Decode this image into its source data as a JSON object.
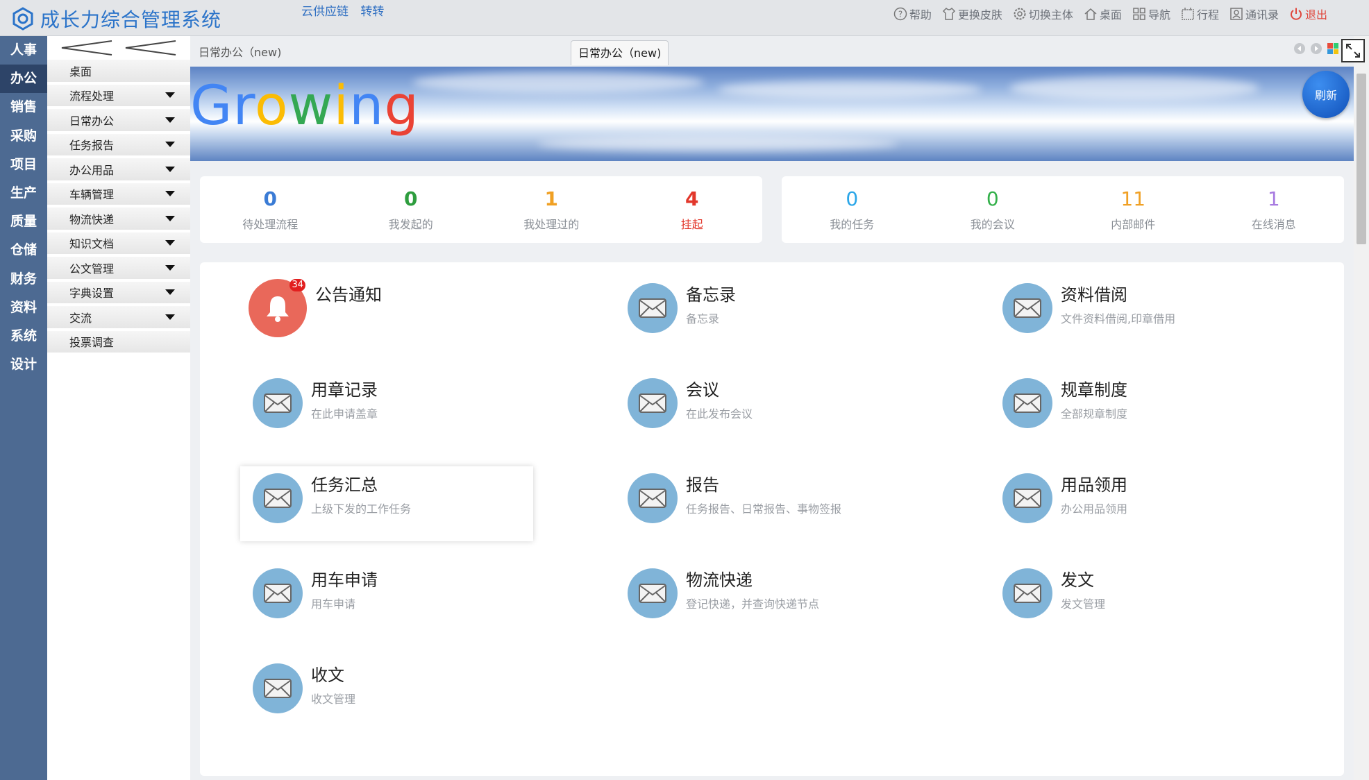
{
  "header": {
    "title": "成长力综合管理系统",
    "links": [
      "云供应链",
      "转转"
    ],
    "tools": [
      {
        "label": "帮助",
        "icon": "help-icon"
      },
      {
        "label": "更换皮肤",
        "icon": "shirt-icon"
      },
      {
        "label": "切换主体",
        "icon": "gear-icon"
      },
      {
        "label": "桌面",
        "icon": "home-icon"
      },
      {
        "label": "导航",
        "icon": "grid-icon"
      },
      {
        "label": "行程",
        "icon": "calendar-icon"
      },
      {
        "label": "通讯录",
        "icon": "contact-icon"
      },
      {
        "label": "退出",
        "icon": "power-icon"
      }
    ]
  },
  "modules": [
    "人事",
    "办公",
    "销售",
    "采购",
    "项目",
    "生产",
    "质量",
    "仓储",
    "财务",
    "资料",
    "系统",
    "设计"
  ],
  "active_module": "办公",
  "menu": [
    "桌面",
    "流程处理",
    "日常办公",
    "任务报告",
    "办公用品",
    "车辆管理",
    "物流快递",
    "知识文档",
    "公文管理",
    "字典设置",
    "交流",
    "投票调查"
  ],
  "breadcrumb": "日常办公（new)",
  "tab": "日常办公（new)",
  "banner": {
    "text": "Growing",
    "refresh_label": "刷新"
  },
  "stats_left": [
    {
      "value": "0",
      "label": "待处理流程",
      "color": "#3a7bd5"
    },
    {
      "value": "0",
      "label": "我发起的",
      "color": "#2e9d3e"
    },
    {
      "value": "1",
      "label": "我处理过的",
      "color": "#f0a024"
    },
    {
      "value": "4",
      "label": "挂起",
      "color": "#e2372b"
    }
  ],
  "stats_right": [
    {
      "value": "0",
      "label": "我的任务",
      "color": "#2aa6e8"
    },
    {
      "value": "0",
      "label": "我的会议",
      "color": "#33b04a"
    },
    {
      "value": "11",
      "label": "内部邮件",
      "color": "#f0a024"
    },
    {
      "value": "1",
      "label": "在线消息",
      "color": "#a77ae0"
    }
  ],
  "apps": [
    {
      "title": "公告通知",
      "sub": "",
      "icon": "bell-icon",
      "badge": "34"
    },
    {
      "title": "备忘录",
      "sub": "备忘录",
      "icon": "mail-icon"
    },
    {
      "title": "资料借阅",
      "sub": "文件资料借阅,印章借用",
      "icon": "mail-icon"
    },
    {
      "title": "用章记录",
      "sub": "在此申请盖章",
      "icon": "mail-icon"
    },
    {
      "title": "会议",
      "sub": "在此发布会议",
      "icon": "mail-icon"
    },
    {
      "title": "规章制度",
      "sub": "全部规章制度",
      "icon": "mail-icon"
    },
    {
      "title": "任务汇总",
      "sub": "上级下发的工作任务",
      "icon": "mail-icon"
    },
    {
      "title": "报告",
      "sub": "任务报告、日常报告、事物签报",
      "icon": "mail-icon"
    },
    {
      "title": "用品领用",
      "sub": "办公用品领用",
      "icon": "mail-icon"
    },
    {
      "title": "用车申请",
      "sub": "用车申请",
      "icon": "mail-icon"
    },
    {
      "title": "物流快递",
      "sub": "登记快递，并查询快递节点",
      "icon": "mail-icon"
    },
    {
      "title": "发文",
      "sub": "发文管理",
      "icon": "mail-icon"
    },
    {
      "title": "收文",
      "sub": "收文管理",
      "icon": "mail-icon"
    }
  ]
}
